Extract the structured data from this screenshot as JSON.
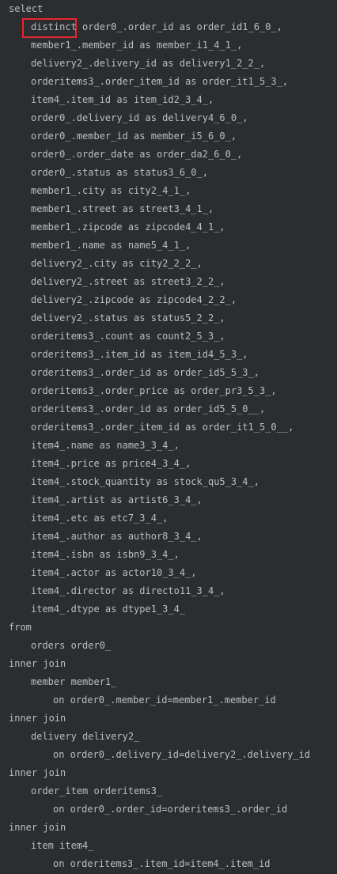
{
  "lines": [
    {
      "indent": 0,
      "text": "select"
    },
    {
      "indent": 1,
      "text": "distinct order0_.order_id as order_id1_6_0_,"
    },
    {
      "indent": 1,
      "text": "member1_.member_id as member_i1_4_1_,"
    },
    {
      "indent": 1,
      "text": "delivery2_.delivery_id as delivery1_2_2_,"
    },
    {
      "indent": 1,
      "text": "orderitems3_.order_item_id as order_it1_5_3_,"
    },
    {
      "indent": 1,
      "text": "item4_.item_id as item_id2_3_4_,"
    },
    {
      "indent": 1,
      "text": "order0_.delivery_id as delivery4_6_0_,"
    },
    {
      "indent": 1,
      "text": "order0_.member_id as member_i5_6_0_,"
    },
    {
      "indent": 1,
      "text": "order0_.order_date as order_da2_6_0_,"
    },
    {
      "indent": 1,
      "text": "order0_.status as status3_6_0_,"
    },
    {
      "indent": 1,
      "text": "member1_.city as city2_4_1_,"
    },
    {
      "indent": 1,
      "text": "member1_.street as street3_4_1_,"
    },
    {
      "indent": 1,
      "text": "member1_.zipcode as zipcode4_4_1_,"
    },
    {
      "indent": 1,
      "text": "member1_.name as name5_4_1_,"
    },
    {
      "indent": 1,
      "text": "delivery2_.city as city2_2_2_,"
    },
    {
      "indent": 1,
      "text": "delivery2_.street as street3_2_2_,"
    },
    {
      "indent": 1,
      "text": "delivery2_.zipcode as zipcode4_2_2_,"
    },
    {
      "indent": 1,
      "text": "delivery2_.status as status5_2_2_,"
    },
    {
      "indent": 1,
      "text": "orderitems3_.count as count2_5_3_,"
    },
    {
      "indent": 1,
      "text": "orderitems3_.item_id as item_id4_5_3_,"
    },
    {
      "indent": 1,
      "text": "orderitems3_.order_id as order_id5_5_3_,"
    },
    {
      "indent": 1,
      "text": "orderitems3_.order_price as order_pr3_5_3_,"
    },
    {
      "indent": 1,
      "text": "orderitems3_.order_id as order_id5_5_0__,"
    },
    {
      "indent": 1,
      "text": "orderitems3_.order_item_id as order_it1_5_0__,"
    },
    {
      "indent": 1,
      "text": "item4_.name as name3_3_4_,"
    },
    {
      "indent": 1,
      "text": "item4_.price as price4_3_4_,"
    },
    {
      "indent": 1,
      "text": "item4_.stock_quantity as stock_qu5_3_4_,"
    },
    {
      "indent": 1,
      "text": "item4_.artist as artist6_3_4_,"
    },
    {
      "indent": 1,
      "text": "item4_.etc as etc7_3_4_,"
    },
    {
      "indent": 1,
      "text": "item4_.author as author8_3_4_,"
    },
    {
      "indent": 1,
      "text": "item4_.isbn as isbn9_3_4_,"
    },
    {
      "indent": 1,
      "text": "item4_.actor as actor10_3_4_,"
    },
    {
      "indent": 1,
      "text": "item4_.director as directo11_3_4_,"
    },
    {
      "indent": 1,
      "text": "item4_.dtype as dtype1_3_4_"
    },
    {
      "indent": 0,
      "text": "from"
    },
    {
      "indent": 1,
      "text": "orders order0_"
    },
    {
      "indent": 0,
      "text": "inner join"
    },
    {
      "indent": 1,
      "text": "member member1_"
    },
    {
      "indent": 2,
      "text": "on order0_.member_id=member1_.member_id"
    },
    {
      "indent": 0,
      "text": "inner join"
    },
    {
      "indent": 1,
      "text": "delivery delivery2_"
    },
    {
      "indent": 2,
      "text": "on order0_.delivery_id=delivery2_.delivery_id"
    },
    {
      "indent": 0,
      "text": "inner join"
    },
    {
      "indent": 1,
      "text": "order_item orderitems3_"
    },
    {
      "indent": 2,
      "text": "on order0_.order_id=orderitems3_.order_id"
    },
    {
      "indent": 0,
      "text": "inner join"
    },
    {
      "indent": 1,
      "text": "item item4_"
    },
    {
      "indent": 2,
      "text": "on orderitems3_.item_id=item4_.item_id"
    }
  ],
  "highlight": {
    "line_index": 1,
    "color": "#e8262c"
  }
}
